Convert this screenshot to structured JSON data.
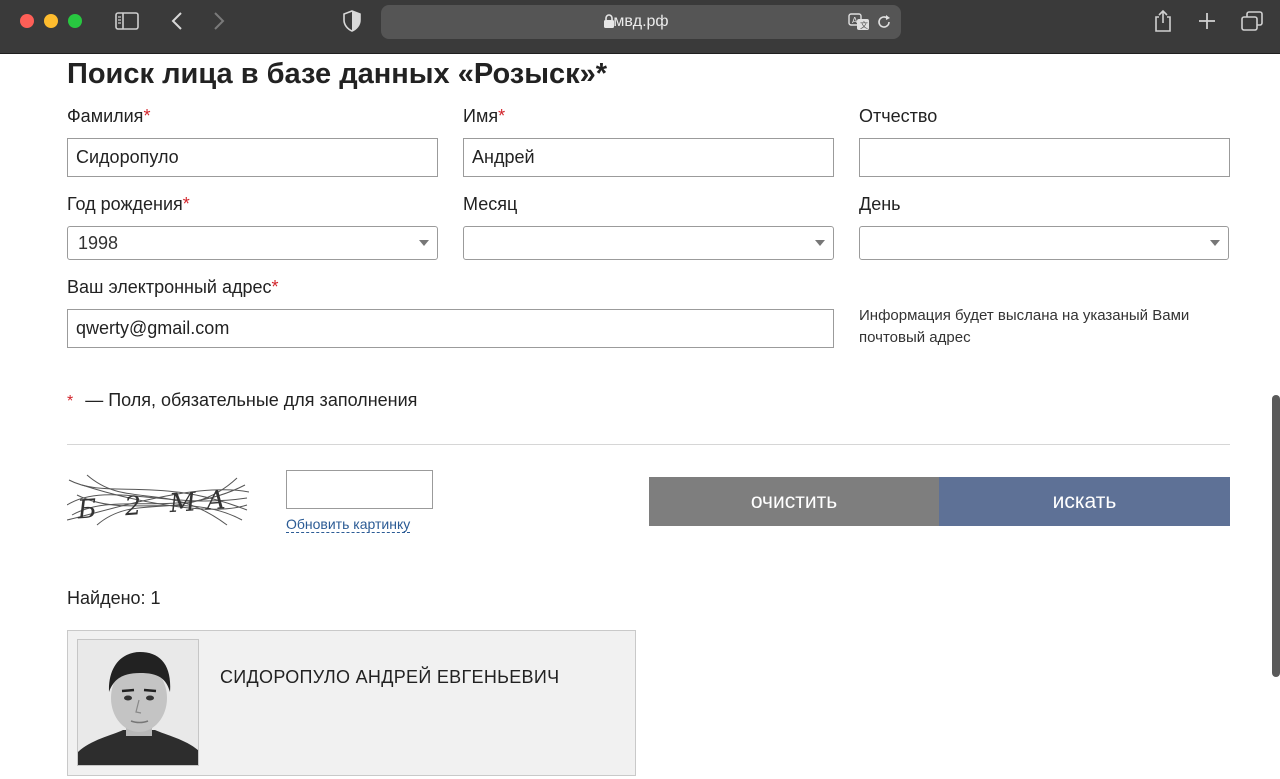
{
  "browser": {
    "url": "мвд.рф"
  },
  "form": {
    "title": "Поиск лица в базе данных «Розыск»*",
    "required_mark": "*",
    "surname": {
      "label": "Фамилия",
      "value": "Сидоропуло"
    },
    "name": {
      "label": "Имя",
      "value": "Андрей"
    },
    "patronymic": {
      "label": "Отчество",
      "value": ""
    },
    "birth_year": {
      "label": "Год рождения",
      "value": "1998"
    },
    "month": {
      "label": "Месяц",
      "value": ""
    },
    "day": {
      "label": "День",
      "value": ""
    },
    "email": {
      "label": "Ваш электронный адрес",
      "value": "qwerty@gmail.com"
    },
    "email_hint": "Информация будет выслана на указаный Вами почтовый адрес",
    "required_note": "— Поля, обязательные для заполнения",
    "captcha_text": "Б 2 МА",
    "refresh_captcha": "Обновить картинку",
    "clear_button": "очистить",
    "search_button": "искать"
  },
  "results": {
    "found_label": "Найдено: 1",
    "items": [
      {
        "name": "СИДОРОПУЛО АНДРЕЙ ЕВГЕНЬЕВИЧ"
      }
    ]
  },
  "colors": {
    "chrome": "#3a3a3a",
    "required": "#d2232a",
    "clear_button": "#7e7e7e",
    "search_button": "#5e7196",
    "link": "#2b5b95"
  }
}
